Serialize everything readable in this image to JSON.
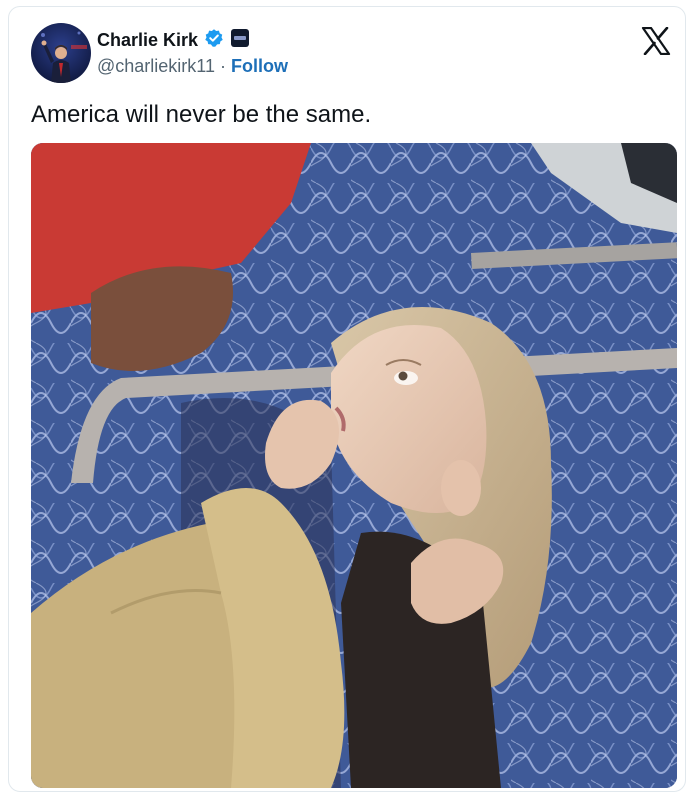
{
  "author": {
    "display_name": "Charlie Kirk",
    "handle": "@charliekirk11",
    "separator": "·",
    "follow_label": "Follow",
    "verified": true,
    "verified_color": "#1d9bf0"
  },
  "tweet": {
    "text": "America will never be the same."
  },
  "icons": {
    "brand": "x-logo-icon",
    "verified": "verified-badge-icon",
    "affiliation": "affiliation-badge-icon"
  },
  "colors": {
    "name": "#0f1419",
    "secondary": "#536471",
    "follow": "#1d6fb8",
    "border": "#e1e8ed"
  }
}
